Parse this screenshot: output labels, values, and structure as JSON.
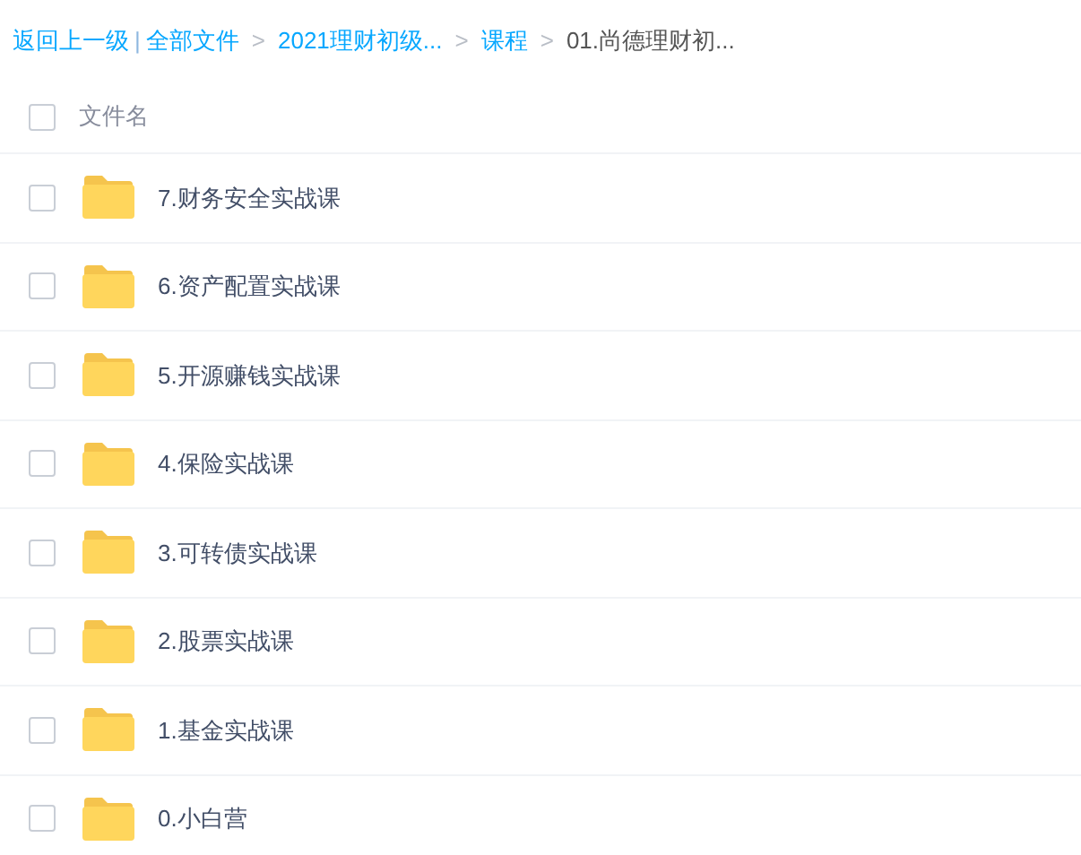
{
  "breadcrumb": {
    "back": "返回上一级",
    "divider": "|",
    "crumbs": [
      {
        "label": "全部文件",
        "current": false
      },
      {
        "separator": ">",
        "label": "2021理财初级...",
        "current": false
      },
      {
        "separator": ">",
        "label": "课程",
        "current": false
      },
      {
        "separator": ">",
        "label": "01.尚德理财初...",
        "current": true
      }
    ]
  },
  "header": {
    "checked": false,
    "column_1": "文件名"
  },
  "files": [
    {
      "name": "7.财务安全实战课",
      "checked": false
    },
    {
      "name": "6.资产配置实战课",
      "checked": false
    },
    {
      "name": "5.开源赚钱实战课",
      "checked": false
    },
    {
      "name": "4.保险实战课",
      "checked": false
    },
    {
      "name": "3.可转债实战课",
      "checked": false
    },
    {
      "name": "2.股票实战课",
      "checked": false
    },
    {
      "name": "1.基金实战课",
      "checked": false
    },
    {
      "name": "0.小白营",
      "checked": false
    }
  ]
}
